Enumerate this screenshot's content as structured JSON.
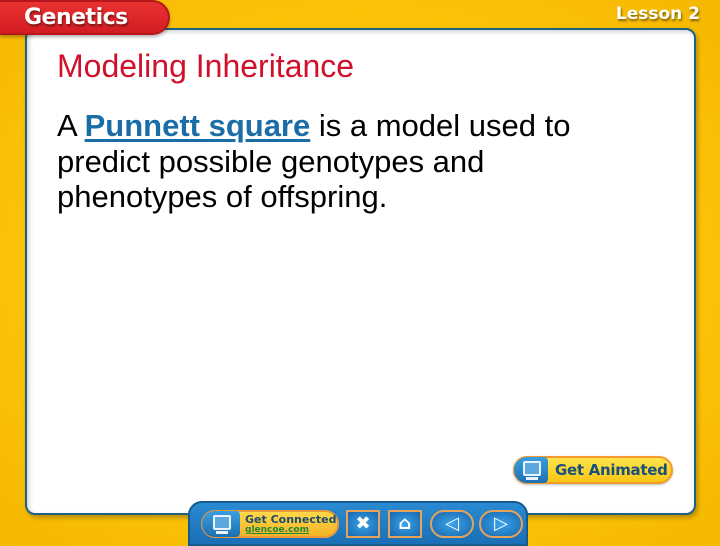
{
  "header": {
    "section_tab": "Genetics",
    "lesson_label": "Lesson 2"
  },
  "slide": {
    "title": "Modeling Inheritance",
    "body": {
      "prefix": "A ",
      "term": "Punnett square",
      "suffix": " is a model used to predict possible genotypes and phenotypes of offspring."
    }
  },
  "buttons": {
    "get_animated": {
      "label": "Get Animated",
      "icon": "monitor-icon"
    },
    "get_connected": {
      "title": "Get Connected",
      "link": "glencoe.com",
      "icon": "monitor-icon"
    }
  },
  "nav": {
    "close": {
      "icon": "close-icon",
      "glyph": "✖"
    },
    "home": {
      "icon": "home-icon",
      "glyph": "⌂"
    },
    "previous": {
      "icon": "previous-arrow-icon",
      "glyph": "◁"
    },
    "next": {
      "icon": "next-arrow-icon",
      "glyph": "▷"
    }
  },
  "colors": {
    "background": "#fcc40a",
    "section_tab": "#d41d24",
    "title": "#d0112b",
    "term_link": "#1b6da8",
    "navbar": "#1a6fb5"
  }
}
